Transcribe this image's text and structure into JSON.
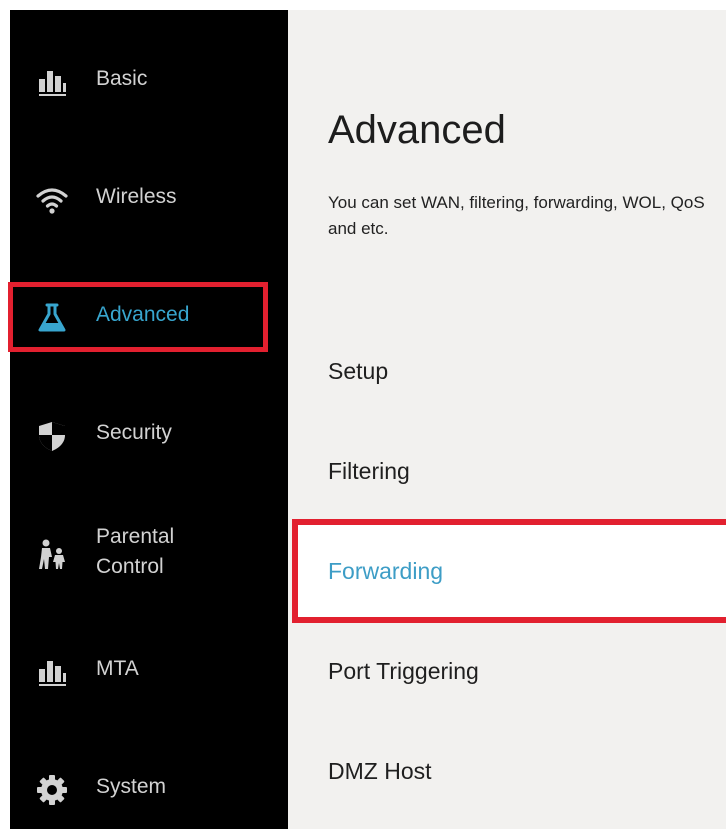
{
  "sidebar": {
    "items": [
      {
        "id": "basic",
        "label": "Basic",
        "icon": "bar-chart-icon"
      },
      {
        "id": "wireless",
        "label": "Wireless",
        "icon": "wifi-icon"
      },
      {
        "id": "advanced",
        "label": "Advanced",
        "icon": "flask-icon",
        "active": true
      },
      {
        "id": "security",
        "label": "Security",
        "icon": "shield-icon"
      },
      {
        "id": "parental",
        "label_line1": "Parental",
        "label_line2": "Control",
        "icon": "family-icon"
      },
      {
        "id": "mta",
        "label": "MTA",
        "icon": "bar-chart-icon"
      },
      {
        "id": "system",
        "label": "System",
        "icon": "gear-icon"
      }
    ]
  },
  "main": {
    "title": "Advanced",
    "description": "You can set WAN, filtering, forwarding, WOL, QoS and etc.",
    "items": [
      {
        "label": "Setup"
      },
      {
        "label": "Filtering"
      },
      {
        "label": "Forwarding",
        "active": true
      },
      {
        "label": "Port Triggering"
      },
      {
        "label": "DMZ Host"
      }
    ]
  },
  "colors": {
    "sidebar_bg": "#000000",
    "main_bg": "#f2f1ef",
    "accent": "#3d9dc6",
    "highlight": "#e2202f",
    "sidebar_text": "#d2d2d2"
  }
}
